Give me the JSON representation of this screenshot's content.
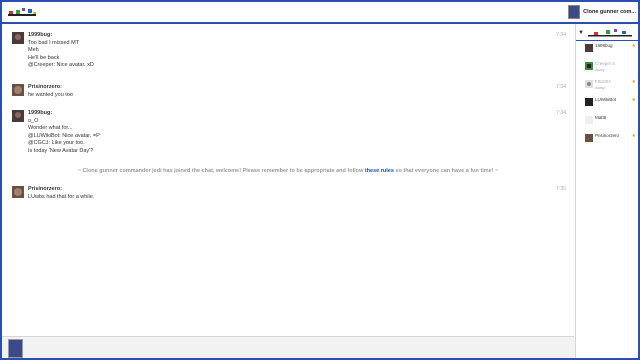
{
  "header": {
    "current_user": "Clone gunner com..."
  },
  "messages": [
    {
      "user": "1999bug:",
      "time": "7:34",
      "lines": [
        "Too bad I missed MT",
        "Meh",
        "He'll be back",
        "@Creeper: Nice avatar. xD"
      ]
    },
    {
      "user": "Prisinorzero:",
      "time": "7:34",
      "lines": [
        "he wanted you too"
      ]
    },
    {
      "user": "1999bug:",
      "time": "7:34",
      "lines": [
        "o_O",
        "Wonder what for...",
        "@LUWikiBot: Nice avatar. =P",
        "@CGCJ: Like your too.",
        "Is today 'New Avatar Day'?"
      ]
    },
    {
      "user": "Prisinorzero:",
      "time": "7:35",
      "lines": [
        "LUwbs had that for a while."
      ]
    }
  ],
  "notice": {
    "before": "~ Clone gunner commander jedi has joined the chat, welcome! Please remember to be appropriate and follow ",
    "link": "these rules",
    "after": " so that everyone can have a fun time! ~"
  },
  "sidebar": {
    "users": [
      {
        "name": "1999bug",
        "status": "",
        "star": "★"
      },
      {
        "name": "Creeper 5",
        "status": "Away",
        "star": ""
      },
      {
        "name": "FB1002",
        "status": "Away",
        "star": "★"
      },
      {
        "name": "LUWikiBot",
        "status": "",
        "star": "★"
      },
      {
        "name": "Matt6",
        "status": "",
        "star": ""
      },
      {
        "name": "Prisinorzero",
        "status": "",
        "star": "★"
      }
    ]
  },
  "colors": {
    "frame": "#2a4fb0",
    "link": "#1c4fbf",
    "star": "#e8a020"
  }
}
